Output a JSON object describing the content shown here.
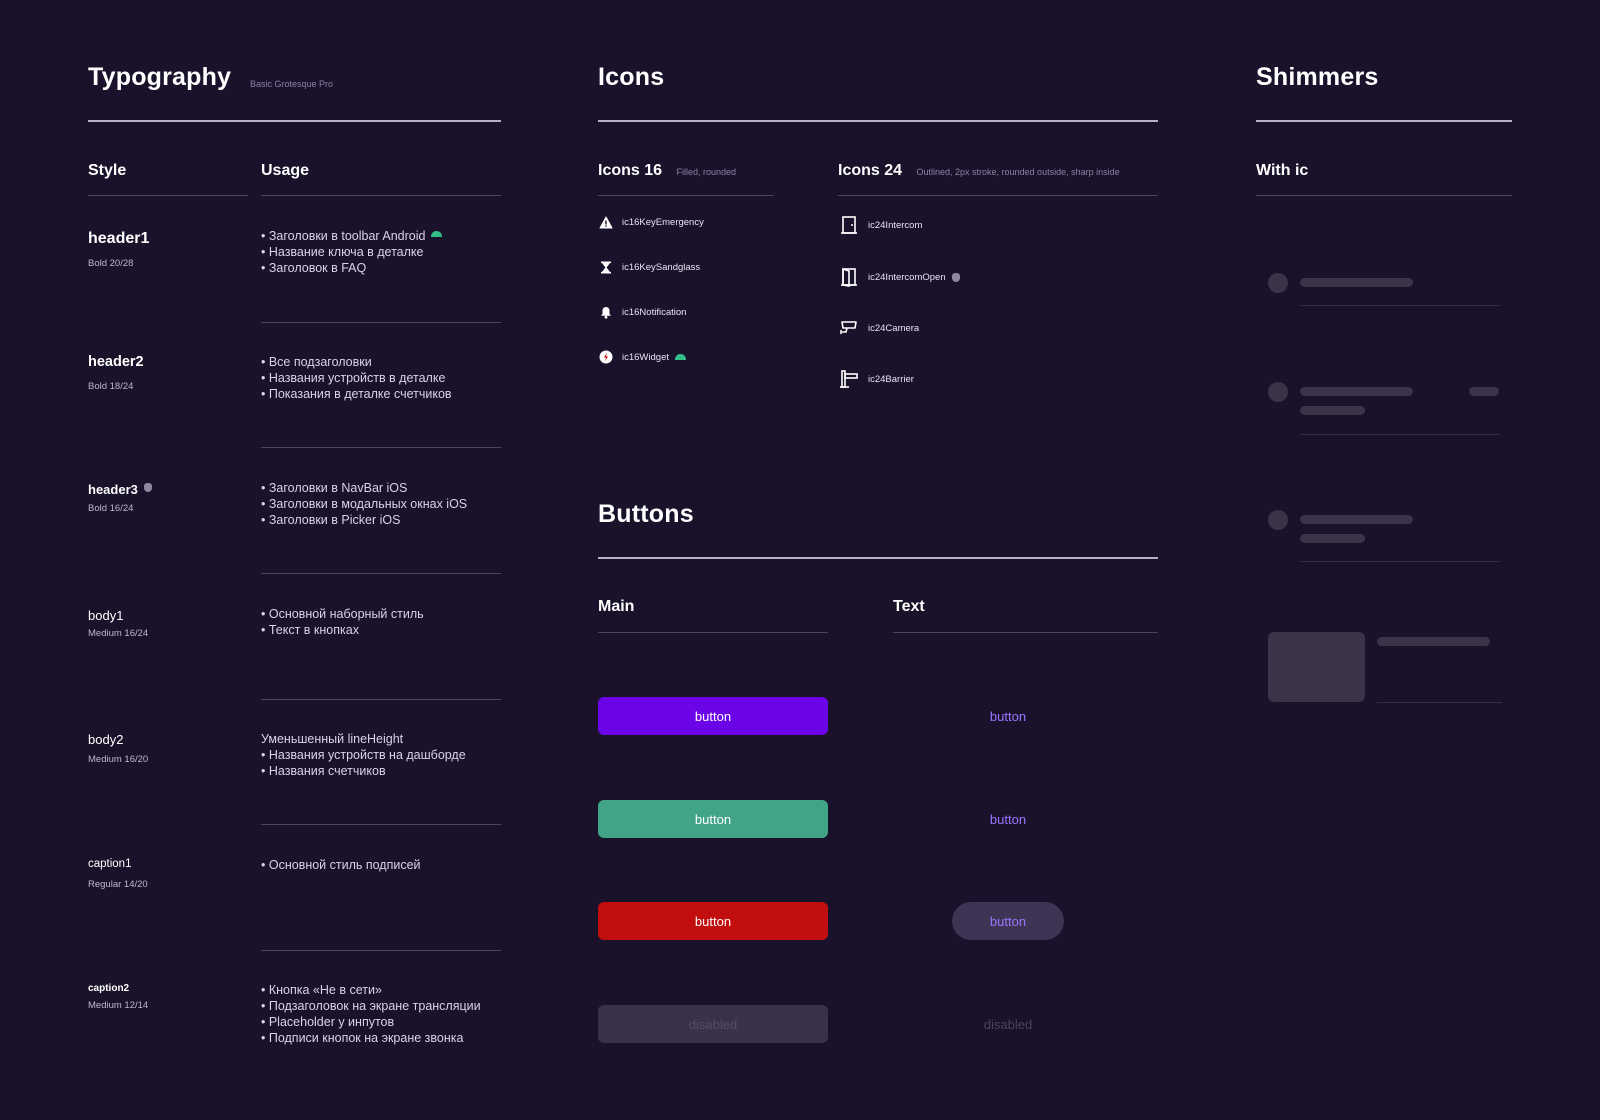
{
  "typography": {
    "title": "Typography",
    "font_name": "Basic Grotesque Pro",
    "col_style": "Style",
    "col_usage": "Usage",
    "rows": [
      {
        "name": "header1",
        "meta": "Bold 20/28",
        "usage": [
          "• Заголовки в toolbar Android",
          "• Название ключа в деталке",
          "• Заголовок в FAQ"
        ]
      },
      {
        "name": "header2",
        "meta": "Bold 18/24",
        "usage": [
          "• Все подзаголовки",
          "• Названия устройств в деталке",
          "• Показания в деталке счетчиков"
        ]
      },
      {
        "name": "header3",
        "meta": "Bold 16/24",
        "usage": [
          "• Заголовки в NavBar iOS",
          "• Заголовки в модальных окнах iOS",
          "• Заголовки в Picker iOS"
        ]
      },
      {
        "name": "body1",
        "meta": "Medium 16/24",
        "usage": [
          "• Основной наборный стиль",
          "• Текст в кнопках"
        ]
      },
      {
        "name": "body2",
        "meta": "Medium 16/20",
        "usage": [
          "Уменьшенный lineHeight",
          "• Названия устройств на дашборде",
          "• Названия счетчиков"
        ]
      },
      {
        "name": "caption1",
        "meta": "Regular 14/20",
        "usage": [
          "• Основной стиль подписей"
        ]
      },
      {
        "name": "caption2",
        "meta": "Medium 12/14",
        "usage": [
          "• Кнопка «Не в сети»",
          "• Подзаголовок на экране трансляции",
          "• Placeholder у инпутов",
          "• Подписи кнопок на экране звонка"
        ]
      }
    ]
  },
  "icons": {
    "title": "Icons",
    "icons16": {
      "label": "Icons 16",
      "sub": "Filled, rounded",
      "items": [
        {
          "icon": "warning-icon",
          "name": "ic16KeyEmergency"
        },
        {
          "icon": "sandglass-icon",
          "name": "ic16KeySandglass"
        },
        {
          "icon": "bell-icon",
          "name": "ic16Notification"
        },
        {
          "icon": "widget-icon",
          "name": "ic16Widget"
        }
      ]
    },
    "icons24": {
      "label": "Icons 24",
      "sub": "Outlined, 2px stroke, rounded outside, sharp inside",
      "items": [
        {
          "icon": "door-icon",
          "name": "ic24Intercom"
        },
        {
          "icon": "door-open-icon",
          "name": "ic24IntercomOpen"
        },
        {
          "icon": "camera-icon",
          "name": "ic24Camera"
        },
        {
          "icon": "barrier-icon",
          "name": "ic24Barrier"
        }
      ]
    }
  },
  "buttons": {
    "title": "Buttons",
    "col_main": "Main",
    "col_text": "Text",
    "label": "button",
    "disabled_label": "disabled",
    "colors": {
      "purple": "#6c04e8",
      "green": "#42a486",
      "red": "#c20e0e",
      "text_accent": "#9a76ff"
    }
  },
  "shimmers": {
    "title": "Shimmers",
    "col": "With ic"
  }
}
